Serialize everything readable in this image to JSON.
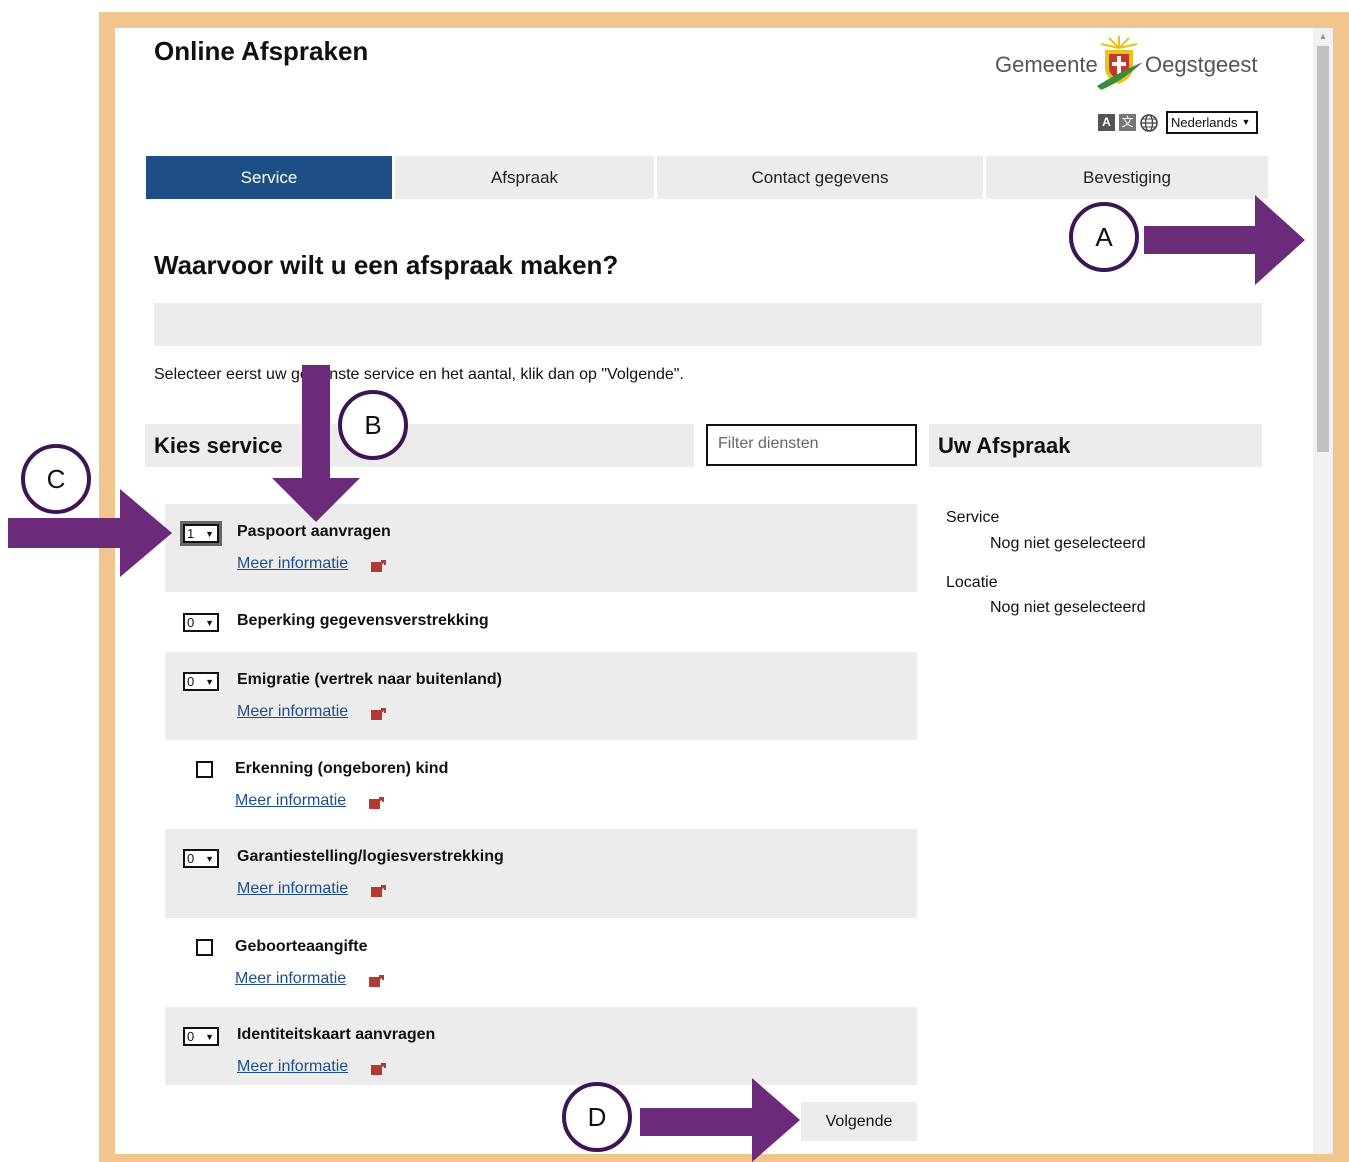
{
  "header": {
    "title": "Online Afspraken",
    "logo_left": "Gemeente",
    "logo_right": "Oegstgeest",
    "language": "Nederlands",
    "tool_a": "A",
    "tool_b": "文"
  },
  "tabs": [
    {
      "label": "Service",
      "active": true
    },
    {
      "label": "Afspraak",
      "active": false
    },
    {
      "label": "Contact gegevens",
      "active": false
    },
    {
      "label": "Bevestiging",
      "active": false
    }
  ],
  "main": {
    "heading": "Waarvoor wilt u een afspraak maken?",
    "instruction": "Selecteer eerst uw gewenste service en het aantal, klik dan op \"Volgende\".",
    "kies_service": "Kies service",
    "filter_placeholder": "Filter diensten",
    "uw_afspraak": "Uw Afspraak"
  },
  "services": [
    {
      "name": "Paspoort aanvragen",
      "control": "select",
      "value": "1",
      "more": "Meer informatie"
    },
    {
      "name": "Beperking gegevensverstrekking",
      "control": "select",
      "value": "0"
    },
    {
      "name": "Emigratie (vertrek naar buitenland)",
      "control": "select",
      "value": "0",
      "more": "Meer informatie"
    },
    {
      "name": "Erkenning (ongeboren) kind",
      "control": "checkbox",
      "more": "Meer informatie"
    },
    {
      "name": "Garantiestelling/logiesverstrekking",
      "control": "select",
      "value": "0",
      "more": "Meer informatie"
    },
    {
      "name": "Geboorteaangifte",
      "control": "checkbox",
      "more": "Meer informatie"
    },
    {
      "name": "Identiteitskaart aanvragen",
      "control": "select",
      "value": "0",
      "more": "Meer informatie"
    }
  ],
  "summary": {
    "service_label": "Service",
    "service_value": "Nog niet geselecteerd",
    "location_label": "Locatie",
    "location_value": "Nog niet geselecteerd"
  },
  "next_button": "Volgende",
  "annotations": [
    {
      "letter": "A"
    },
    {
      "letter": "B"
    },
    {
      "letter": "C"
    },
    {
      "letter": "D"
    }
  ],
  "colors": {
    "frame": "#f2c58c",
    "active_tab": "#1d4f86",
    "arrow": "#6b2a7a",
    "link": "#1f4e8c"
  }
}
